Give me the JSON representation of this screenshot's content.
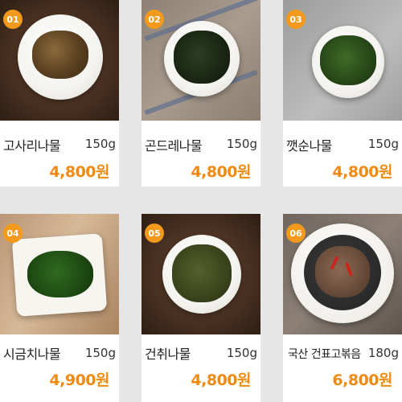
{
  "products": [
    {
      "badge": "01",
      "name": "고사리나물",
      "weight": "150g",
      "price": "4,800원"
    },
    {
      "badge": "02",
      "name": "곤드레나물",
      "weight": "150g",
      "price": "4,800원"
    },
    {
      "badge": "03",
      "name": "깻순나물",
      "weight": "150g",
      "price": "4,800원"
    },
    {
      "badge": "04",
      "name": "시금치나물",
      "weight": "150g",
      "price": "4,900원"
    },
    {
      "badge": "05",
      "name": "건취나물",
      "weight": "150g",
      "price": "4,800원"
    },
    {
      "badge": "06",
      "name": "국산 건표고볶음",
      "weight": "180g",
      "price": "6,800원"
    }
  ],
  "colors": {
    "badge": "#f39a1d",
    "price": "#f08a12"
  }
}
